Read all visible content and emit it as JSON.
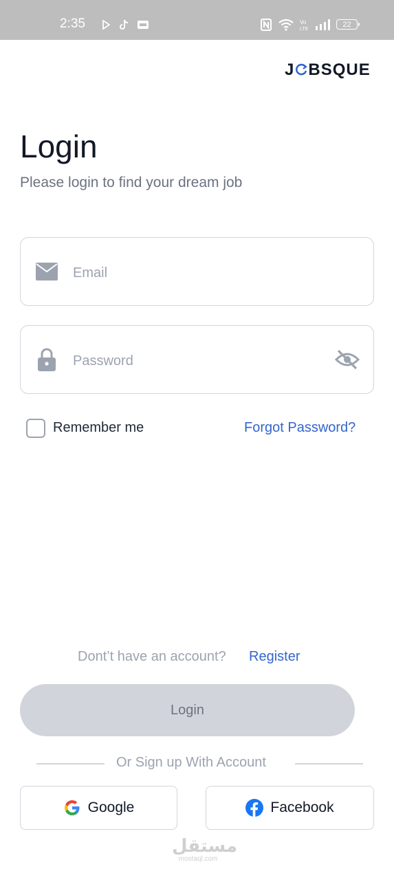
{
  "status_bar": {
    "time": "2:35",
    "battery_level": "22",
    "icons": [
      "play-icon",
      "tiktok-icon",
      "gallery-icon",
      "nfc-icon",
      "wifi-icon",
      "volte-icon",
      "signal-icon",
      "battery-icon"
    ]
  },
  "header": {
    "logo_text_1": "J",
    "logo_text_2": "BSQUE"
  },
  "page": {
    "title": "Login",
    "subtitle": "Please login to find your dream job"
  },
  "form": {
    "email_placeholder": "Email",
    "email_value": "",
    "password_placeholder": "Password",
    "password_value": "",
    "remember_label": "Remember me",
    "remember_checked": false,
    "forgot_label": "Forgot Password?"
  },
  "footer": {
    "no_account_text": "Dont’t have an account?",
    "register_label": "Register",
    "login_label": "Login",
    "divider_text": "Or Sign up With Account",
    "google_label": "Google",
    "facebook_label": "Facebook"
  },
  "watermark": {
    "arabic": "مستقل",
    "latin": "mostaql.com"
  },
  "colors": {
    "accent": "#3366cc",
    "disabled_button": "#d1d5db",
    "status_bar": "#bdbdbd"
  }
}
